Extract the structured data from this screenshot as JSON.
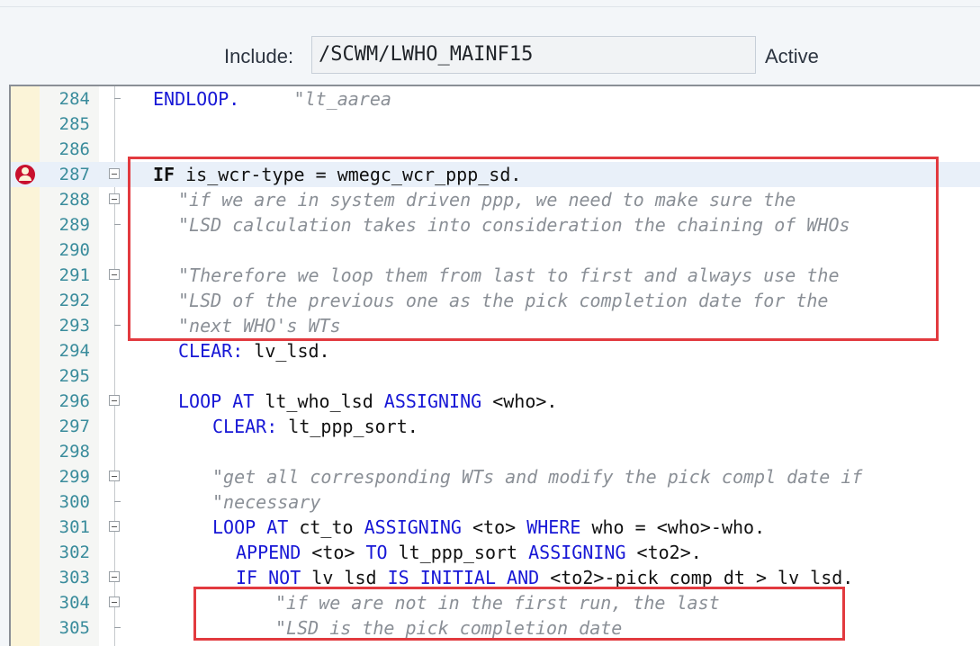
{
  "include": {
    "label": "Include:",
    "value": "/SCWM/LWHO_MAINF15",
    "status": "Active"
  },
  "editor": {
    "lines": [
      {
        "num": "284",
        "fold": "end",
        "indent": 0,
        "parts": [
          [
            "kw",
            "ENDLOOP."
          ],
          [
            "txt",
            "     "
          ],
          [
            "cm",
            "\"lt_aarea"
          ]
        ]
      },
      {
        "num": "285",
        "fold": "none",
        "indent": 0,
        "parts": []
      },
      {
        "num": "286",
        "fold": "none",
        "indent": 0,
        "parts": []
      },
      {
        "num": "287",
        "fold": "open",
        "indent": 0,
        "breakpoint": true,
        "current": true,
        "parts": [
          [
            "kwb",
            "IF"
          ],
          [
            "txt",
            " is_wcr-type = wmegc_wcr_ppp_sd."
          ]
        ]
      },
      {
        "num": "288",
        "fold": "open",
        "indent": 1,
        "parts": [
          [
            "cm",
            "\"if we are in system driven ppp, we need to make sure the"
          ]
        ]
      },
      {
        "num": "289",
        "fold": "end",
        "indent": 1,
        "parts": [
          [
            "cm",
            "\"LSD calculation takes into consideration the chaining of WHOs"
          ]
        ]
      },
      {
        "num": "290",
        "fold": "none",
        "indent": 0,
        "parts": []
      },
      {
        "num": "291",
        "fold": "open",
        "indent": 1,
        "parts": [
          [
            "cm",
            "\"Therefore we loop them from last to first and always use the"
          ]
        ]
      },
      {
        "num": "292",
        "fold": "none",
        "indent": 1,
        "parts": [
          [
            "cm",
            "\"LSD of the previous one as the pick completion date for the"
          ]
        ]
      },
      {
        "num": "293",
        "fold": "end",
        "indent": 1,
        "parts": [
          [
            "cm",
            "\"next WHO's WTs"
          ]
        ]
      },
      {
        "num": "294",
        "fold": "none",
        "indent": 1,
        "parts": [
          [
            "kw",
            "CLEAR:"
          ],
          [
            "txt",
            " lv_lsd."
          ]
        ]
      },
      {
        "num": "295",
        "fold": "none",
        "indent": 0,
        "parts": []
      },
      {
        "num": "296",
        "fold": "open",
        "indent": 1,
        "parts": [
          [
            "kw",
            "LOOP AT"
          ],
          [
            "txt",
            " lt_who_lsd "
          ],
          [
            "kw",
            "ASSIGNING"
          ],
          [
            "txt",
            " <who>."
          ]
        ]
      },
      {
        "num": "297",
        "fold": "none",
        "indent": 2,
        "parts": [
          [
            "kw",
            "CLEAR:"
          ],
          [
            "txt",
            " lt_ppp_sort."
          ]
        ]
      },
      {
        "num": "298",
        "fold": "none",
        "indent": 0,
        "parts": []
      },
      {
        "num": "299",
        "fold": "open",
        "indent": 2,
        "parts": [
          [
            "cm",
            "\"get all corresponding WTs and modify the pick compl date if"
          ]
        ]
      },
      {
        "num": "300",
        "fold": "end",
        "indent": 2,
        "parts": [
          [
            "cm",
            "\"necessary"
          ]
        ]
      },
      {
        "num": "301",
        "fold": "open",
        "indent": 2,
        "parts": [
          [
            "kw",
            "LOOP AT"
          ],
          [
            "txt",
            " ct_to "
          ],
          [
            "kw",
            "ASSIGNING"
          ],
          [
            "txt",
            " <to> "
          ],
          [
            "kw",
            "WHERE"
          ],
          [
            "txt",
            " who = <who>-who."
          ]
        ]
      },
      {
        "num": "302",
        "fold": "none",
        "indent": 3,
        "parts": [
          [
            "kw",
            "APPEND"
          ],
          [
            "txt",
            " <to> "
          ],
          [
            "kw",
            "TO"
          ],
          [
            "txt",
            " lt_ppp_sort "
          ],
          [
            "kw",
            "ASSIGNING"
          ],
          [
            "txt",
            " <to2>."
          ]
        ]
      },
      {
        "num": "303",
        "fold": "open",
        "indent": 3,
        "parts": [
          [
            "kw",
            "IF NOT"
          ],
          [
            "txt",
            " lv_lsd "
          ],
          [
            "kw",
            "IS INITIAL AND"
          ],
          [
            "txt",
            " <to2>-pick_comp_dt > lv_lsd."
          ]
        ]
      },
      {
        "num": "304",
        "fold": "open",
        "indent": 4,
        "parts": [
          [
            "cm",
            "\"if we are not in the first run, the last"
          ]
        ]
      },
      {
        "num": "305",
        "fold": "end",
        "indent": 4,
        "parts": [
          [
            "cm",
            "\"LSD is the pick completion date"
          ]
        ]
      }
    ]
  }
}
